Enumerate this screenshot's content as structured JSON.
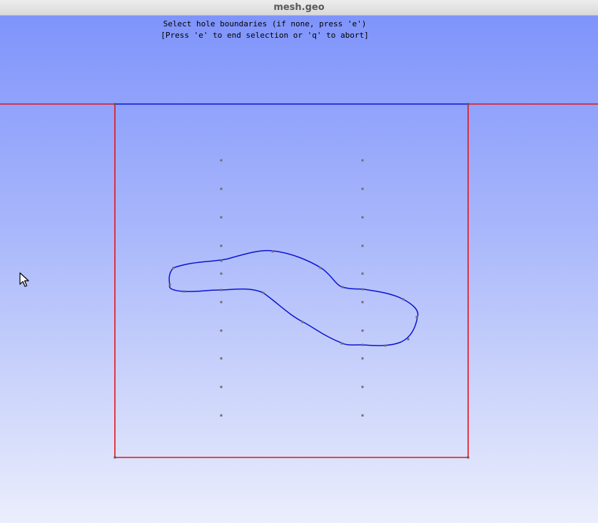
{
  "window": {
    "title": "mesh.geo"
  },
  "status": {
    "line1": "Select hole boundaries (if none, press 'e')",
    "line2": "[Press 'e' to end selection or 'q' to abort]"
  },
  "colors": {
    "selected_line": "#e8101c",
    "highlighted_line": "#0a14d4",
    "point": "#6f6f6f",
    "background_top": "#7f94fb",
    "background_bottom": "#ebeefc"
  },
  "icons": {
    "cursor": "mouse-pointer-icon"
  }
}
